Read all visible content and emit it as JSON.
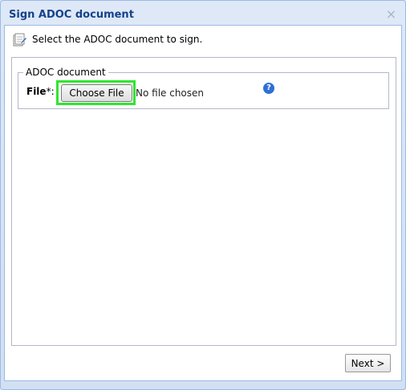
{
  "dialog": {
    "title": "Sign ADOC document",
    "instruction": "Select the ADOC document to sign.",
    "fieldset_legend": "ADOC document",
    "file_label": "File",
    "file_required": "*:",
    "choose_button": "Choose File",
    "no_file": "No file chosen",
    "help_icon": "?",
    "close_icon": "×",
    "next_button": "Next >"
  },
  "icons": {
    "title_close": "close-icon",
    "instruction": "document-sign-icon",
    "help": "help-icon"
  },
  "colors": {
    "highlight": "#2ee62e",
    "title_text": "#15428b",
    "help_icon": "#2f6fd6"
  }
}
